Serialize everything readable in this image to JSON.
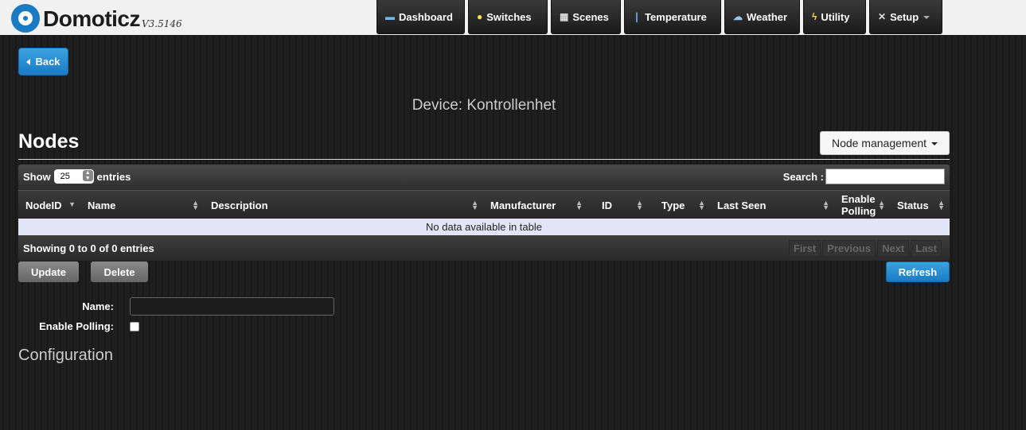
{
  "app": {
    "name": "Domoticz",
    "version": "V3.5146"
  },
  "nav": [
    {
      "label": "Dashboard",
      "icon": "monitor-icon"
    },
    {
      "label": "Switches",
      "icon": "lightbulb-icon"
    },
    {
      "label": "Scenes",
      "icon": "clapperboard-icon"
    },
    {
      "label": "Temperature",
      "icon": "thermometer-icon"
    },
    {
      "label": "Weather",
      "icon": "cloud-rain-icon"
    },
    {
      "label": "Utility",
      "icon": "lightning-icon"
    },
    {
      "label": "Setup",
      "icon": "tools-icon"
    }
  ],
  "back_label": "Back",
  "device_title": "Device: Kontrollenhet",
  "nodes_title": "Nodes",
  "node_management_label": "Node management",
  "table": {
    "show_label": "Show",
    "show_value": "25",
    "entries_label": "entries",
    "search_label": "Search :",
    "columns": [
      "NodeID",
      "Name",
      "Description",
      "Manufacturer",
      "ID",
      "Type",
      "Last Seen",
      "Enable Polling",
      "Status"
    ],
    "empty_message": "No data available in table",
    "info": "Showing 0 to 0 of 0 entries",
    "pager": [
      "First",
      "Previous",
      "Next",
      "Last"
    ]
  },
  "actions": {
    "update": "Update",
    "delete": "Delete",
    "refresh": "Refresh"
  },
  "form": {
    "name_label": "Name:",
    "name_value": "",
    "polling_label": "Enable Polling:",
    "polling_checked": false
  },
  "configuration_title": "Configuration"
}
